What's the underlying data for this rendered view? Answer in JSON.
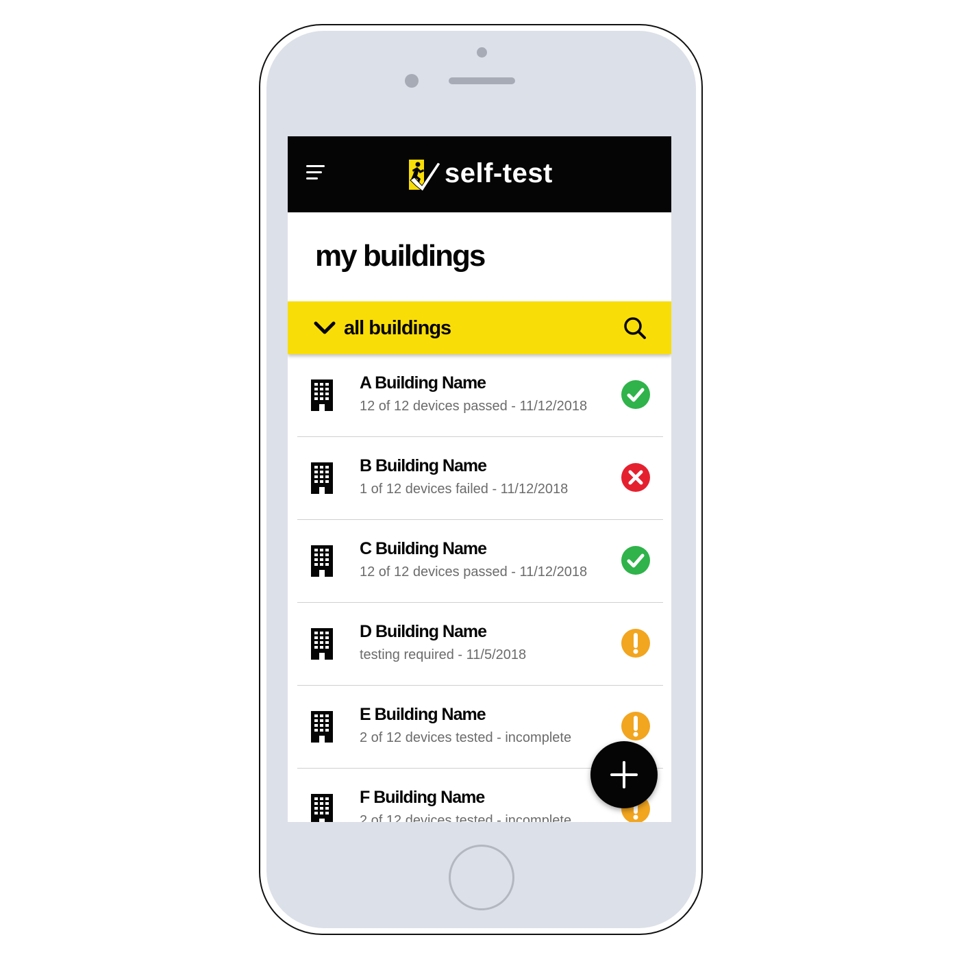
{
  "app": {
    "title": "self-test",
    "brand_color": "#f9dd07",
    "header_color": "#050505"
  },
  "page": {
    "title": "my buildings"
  },
  "filter": {
    "label": "all buildings"
  },
  "status_colors": {
    "passed": "#2fb34a",
    "failed": "#e5202e",
    "warning": "#f2a51f"
  },
  "buildings": [
    {
      "name": "A Building Name",
      "status_text": "12 of 12 devices passed - 11/12/2018",
      "status": "passed",
      "icon": "check-circle-icon"
    },
    {
      "name": "B Building Name",
      "status_text": "1 of 12 devices failed - 11/12/2018",
      "status": "failed",
      "icon": "x-circle-icon"
    },
    {
      "name": "C Building Name",
      "status_text": "12 of 12 devices passed - 11/12/2018",
      "status": "passed",
      "icon": "check-circle-icon"
    },
    {
      "name": "D Building Name",
      "status_text": "testing required - 11/5/2018",
      "status": "warning",
      "icon": "exclamation-circle-icon"
    },
    {
      "name": "E Building Name",
      "status_text": "2 of 12 devices tested - incomplete",
      "status": "warning",
      "icon": "exclamation-circle-icon"
    },
    {
      "name": "F Building Name",
      "status_text": "2 of 12 devices tested - incomplete",
      "status": "warning",
      "icon": "exclamation-circle-icon"
    }
  ],
  "icons": {
    "menu": "menu-icon",
    "logo": "self-test-logo",
    "filter_toggle": "chevron-down-icon",
    "search": "search-icon",
    "building": "building-icon",
    "add": "plus-icon"
  }
}
